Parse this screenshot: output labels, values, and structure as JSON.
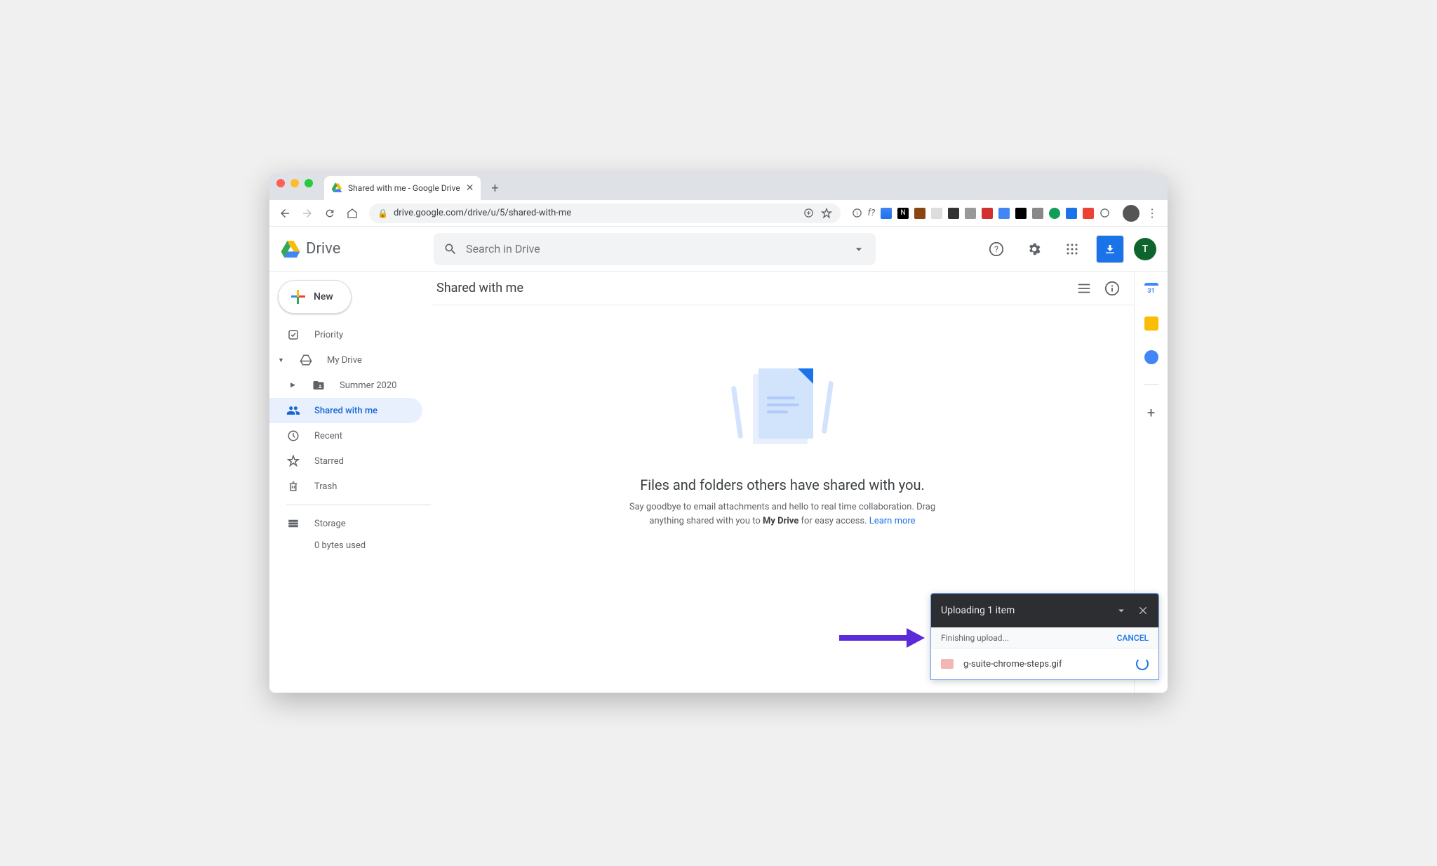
{
  "browser": {
    "tab_title": "Shared with me - Google Drive",
    "url": "drive.google.com/drive/u/5/shared-with-me"
  },
  "header": {
    "app_name": "Drive",
    "search_placeholder": "Search in Drive",
    "user_initial": "T"
  },
  "sidebar": {
    "new_label": "New",
    "items": {
      "priority": "Priority",
      "my_drive": "My Drive",
      "summer_folder": "Summer 2020",
      "shared_with_me": "Shared with me",
      "recent": "Recent",
      "starred": "Starred",
      "trash": "Trash",
      "storage": "Storage"
    },
    "storage_used": "0 bytes used"
  },
  "content": {
    "title": "Shared with me",
    "empty_heading": "Files and folders others have shared with you.",
    "empty_desc_1": "Say goodbye to email attachments and hello to real time collaboration. Drag anything shared with you to ",
    "empty_desc_bold": "My Drive",
    "empty_desc_2": " for easy access. ",
    "learn_more": "Learn more"
  },
  "upload": {
    "title": "Uploading 1 item",
    "status": "Finishing upload...",
    "cancel": "CANCEL",
    "file_name": "g-suite-chrome-steps.gif"
  }
}
